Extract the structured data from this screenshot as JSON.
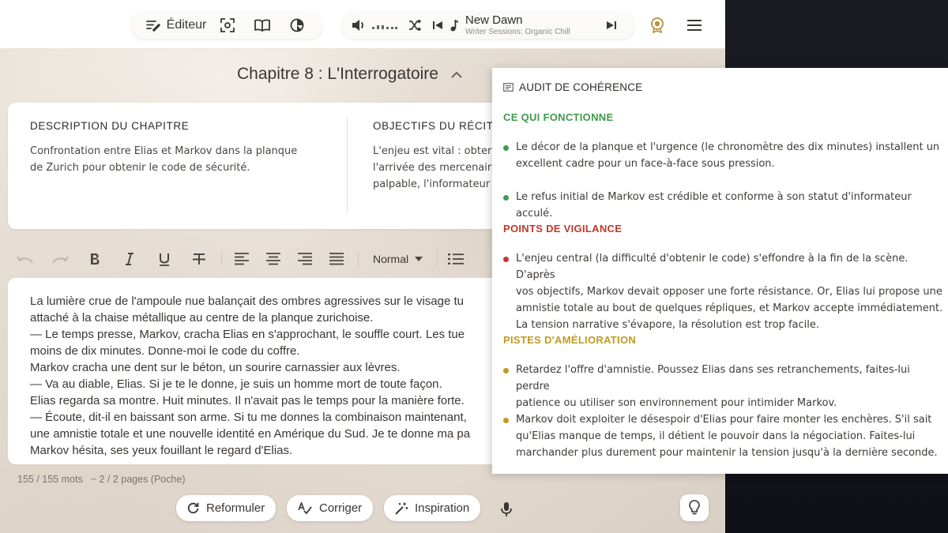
{
  "topbar": {
    "editor_label": "Éditeur",
    "track_title": "New Dawn",
    "track_subtitle": "Writer Sessions: Organic Chill"
  },
  "chapter": {
    "title": "Chapitre 8 : L'Interrogatoire"
  },
  "description": {
    "heading": "DESCRIPTION DU CHAPITRE",
    "text_line1": "Confrontation entre Elias et Markov dans la planque",
    "text_line2": "de Zurich pour obtenir le code de sécurité."
  },
  "objectives": {
    "heading": "OBJECTIFS DU RÉCIT",
    "line1": "L'enjeu est vital : obter",
    "line2": "l'arrivée des mercenair",
    "line3": "palpable, l'informateur"
  },
  "format": {
    "style_select": "Normal"
  },
  "editor": {
    "lines": [
      "La lumière crue de l'ampoule nue balançait des ombres agressives sur le visage tu",
      "attaché à la chaise métallique au centre de la planque zurichoise.",
      "— Le temps presse, Markov, cracha Elias en s'approchant, le souffle court. Les tue",
      "moins de dix minutes. Donne-moi le code du coffre.",
      "Markov cracha une dent sur le béton, un sourire carnassier aux lèvres.",
      "— Va au diable, Elias. Si je te le donne, je suis un homme mort de toute façon.",
      "Elias regarda sa montre. Huit minutes. Il n'avait pas le temps pour la manière forte.",
      "— Écoute, dit-il en baissant son arme. Si tu me donnes la combinaison maintenant,",
      "une amnistie totale et une nouvelle identité en Amérique du Sud. Je te donne ma pa",
      "Markov hésita, ses yeux fouillant le regard d'Elias."
    ]
  },
  "stats": {
    "words": "155 / 155 mots",
    "pages": "~ 2 / 2 pages (Poche)"
  },
  "actions": {
    "rephrase": "Reformuler",
    "correct": "Corriger",
    "inspiration": "Inspiration"
  },
  "audit": {
    "title": "AUDIT DE COHÉRENCE",
    "works_title": "CE QUI FONCTIONNE",
    "works": [
      [
        "Le décor de la planque et l'urgence (le chronomètre des dix minutes) installent un",
        "excellent cadre pour un face-à-face sous pression."
      ],
      [
        "Le refus initial de Markov est crédible et conforme à son statut d'informateur acculé."
      ]
    ],
    "vigilance_title": "POINTS DE VIGILANCE",
    "vigilance": [
      [
        "L'enjeu central (la difficulté d'obtenir le code) s'effondre à la fin de la scène. D'après",
        "vos objectifs, Markov devait opposer une forte résistance. Or, Elias lui propose une",
        "amnistie totale au bout de quelques répliques, et Markov accepte immédiatement.",
        "La tension narrative s'évapore, la résolution est trop facile."
      ]
    ],
    "improve_title": "PISTES D'AMÉLIORATION",
    "improve": [
      [
        "Retardez l'offre d'amnistie. Poussez Elias dans ses retranchements, faites-lui perdre",
        "patience ou utiliser son environnement pour intimider Markov."
      ],
      [
        "Markov doit exploiter le désespoir d'Elias pour faire monter les enchères. S'il sait",
        "qu'Elias manque de temps, il détient le pouvoir dans la négociation. Faites-lui",
        "marchander plus durement pour maintenir la tension jusqu'à la dernière seconde."
      ]
    ],
    "colors": {
      "green": "#3f9a4b",
      "red": "#c0392b",
      "gold": "#c39a1f"
    }
  }
}
